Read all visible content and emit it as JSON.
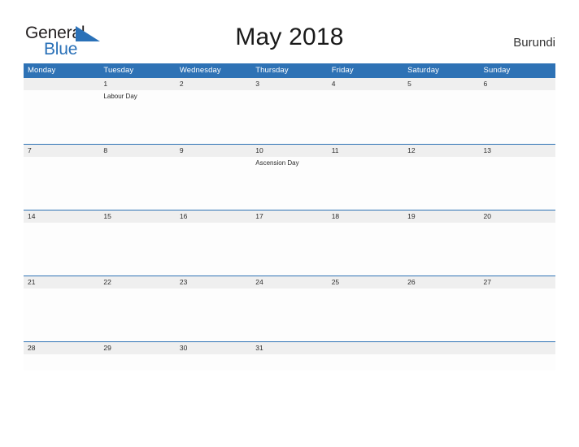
{
  "brand": {
    "name_line1": "General",
    "name_line2": "Blue",
    "flag_icon": "blue-flag-triangle-icon",
    "color_primary": "#2a71b8",
    "color_text": "#231f20"
  },
  "header": {
    "title": "May 2018",
    "country": "Burundi"
  },
  "calendar": {
    "header_color": "#2e72b5",
    "date_band_color": "#efefef",
    "weekdays": [
      "Monday",
      "Tuesday",
      "Wednesday",
      "Thursday",
      "Friday",
      "Saturday",
      "Sunday"
    ],
    "weeks": [
      {
        "days": [
          {
            "date": "",
            "events": []
          },
          {
            "date": "1",
            "events": [
              "Labour Day"
            ]
          },
          {
            "date": "2",
            "events": []
          },
          {
            "date": "3",
            "events": []
          },
          {
            "date": "4",
            "events": []
          },
          {
            "date": "5",
            "events": []
          },
          {
            "date": "6",
            "events": []
          }
        ]
      },
      {
        "days": [
          {
            "date": "7",
            "events": []
          },
          {
            "date": "8",
            "events": []
          },
          {
            "date": "9",
            "events": []
          },
          {
            "date": "10",
            "events": [
              "Ascension Day"
            ]
          },
          {
            "date": "11",
            "events": []
          },
          {
            "date": "12",
            "events": []
          },
          {
            "date": "13",
            "events": []
          }
        ]
      },
      {
        "days": [
          {
            "date": "14",
            "events": []
          },
          {
            "date": "15",
            "events": []
          },
          {
            "date": "16",
            "events": []
          },
          {
            "date": "17",
            "events": []
          },
          {
            "date": "18",
            "events": []
          },
          {
            "date": "19",
            "events": []
          },
          {
            "date": "20",
            "events": []
          }
        ]
      },
      {
        "days": [
          {
            "date": "21",
            "events": []
          },
          {
            "date": "22",
            "events": []
          },
          {
            "date": "23",
            "events": []
          },
          {
            "date": "24",
            "events": []
          },
          {
            "date": "25",
            "events": []
          },
          {
            "date": "26",
            "events": []
          },
          {
            "date": "27",
            "events": []
          }
        ]
      },
      {
        "days": [
          {
            "date": "28",
            "events": []
          },
          {
            "date": "29",
            "events": []
          },
          {
            "date": "30",
            "events": []
          },
          {
            "date": "31",
            "events": []
          },
          {
            "date": "",
            "events": []
          },
          {
            "date": "",
            "events": []
          },
          {
            "date": "",
            "events": []
          }
        ]
      }
    ]
  }
}
